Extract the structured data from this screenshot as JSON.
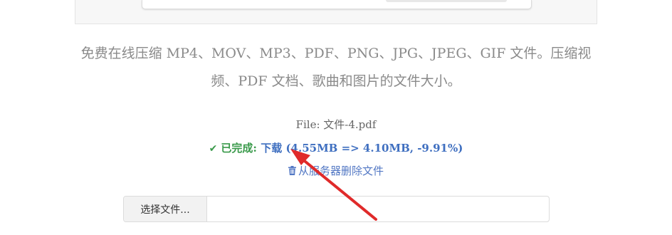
{
  "description": {
    "line1": "免费在线压缩 MP4、MOV、MP3、PDF、PNG、JPG、JPEG、GIF 文件。压缩视",
    "line2": "频、PDF 文档、歌曲和图片的文件大小。"
  },
  "file": {
    "label": "File: 文件-4.pdf"
  },
  "status": {
    "done_label": "已完成:",
    "download_label": "下载",
    "sizes_text": "(4.55MB => 4.10MB, -9.91%)"
  },
  "delete": {
    "label": "从服务器删除文件"
  },
  "upload": {
    "choose_button_label": "选择文件..."
  },
  "icons": {
    "check": "check-icon",
    "trash": "trash-icon"
  },
  "colors": {
    "success": "#3a9a4b",
    "link": "#3f6fc0",
    "arrow": "#e02a2a"
  }
}
